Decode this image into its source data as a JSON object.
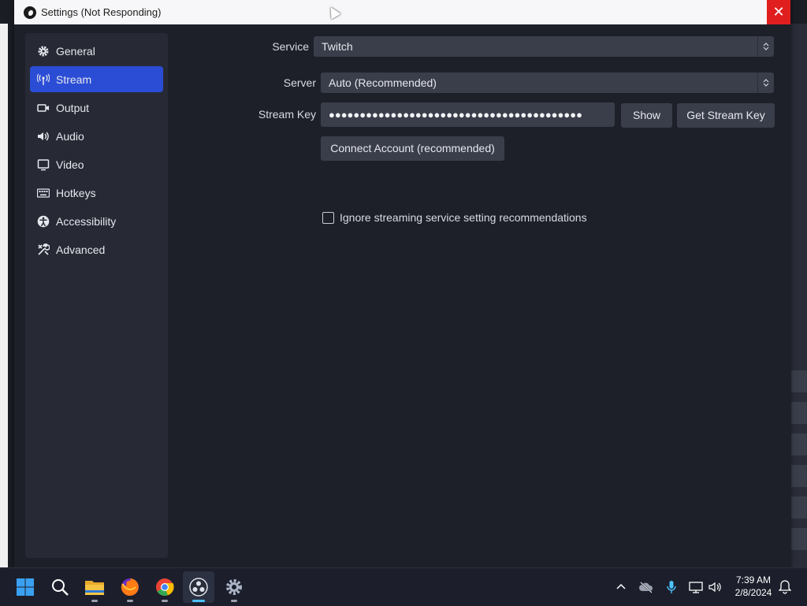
{
  "window": {
    "title": "Settings (Not Responding)",
    "close_glyph": "✕"
  },
  "sidebar": {
    "items": [
      {
        "label": "General",
        "icon": "gear-icon"
      },
      {
        "label": "Stream",
        "icon": "broadcast-icon",
        "active": true
      },
      {
        "label": "Output",
        "icon": "camera-icon"
      },
      {
        "label": "Audio",
        "icon": "speaker-icon"
      },
      {
        "label": "Video",
        "icon": "monitor-icon"
      },
      {
        "label": "Hotkeys",
        "icon": "keyboard-icon"
      },
      {
        "label": "Accessibility",
        "icon": "accessibility-icon"
      },
      {
        "label": "Advanced",
        "icon": "tools-icon"
      }
    ]
  },
  "stream": {
    "service_label": "Service",
    "service_value": "Twitch",
    "server_label": "Server",
    "server_value": "Auto (Recommended)",
    "key_label": "Stream Key",
    "key_value": "●●●●●●●●●●●●●●●●●●●●●●●●●●●●●●●●●●●●●●●●●",
    "show_button": "Show",
    "get_key_button": "Get Stream Key",
    "connect_button": "Connect Account (recommended)",
    "ignore_checkbox_label": "Ignore streaming service setting recommendations",
    "ignore_checked": false
  },
  "taskbar": {
    "apps": [
      "windows-start-icon",
      "search-icon",
      "file-explorer-icon",
      "firefox-icon",
      "chrome-icon",
      "obs-icon",
      "settings-icon"
    ],
    "clock_time": "7:39 AM",
    "clock_date": "2/8/2024"
  },
  "colors": {
    "accent": "#2b4dd6",
    "close": "#e01e1e",
    "panel": "#1e2029"
  }
}
